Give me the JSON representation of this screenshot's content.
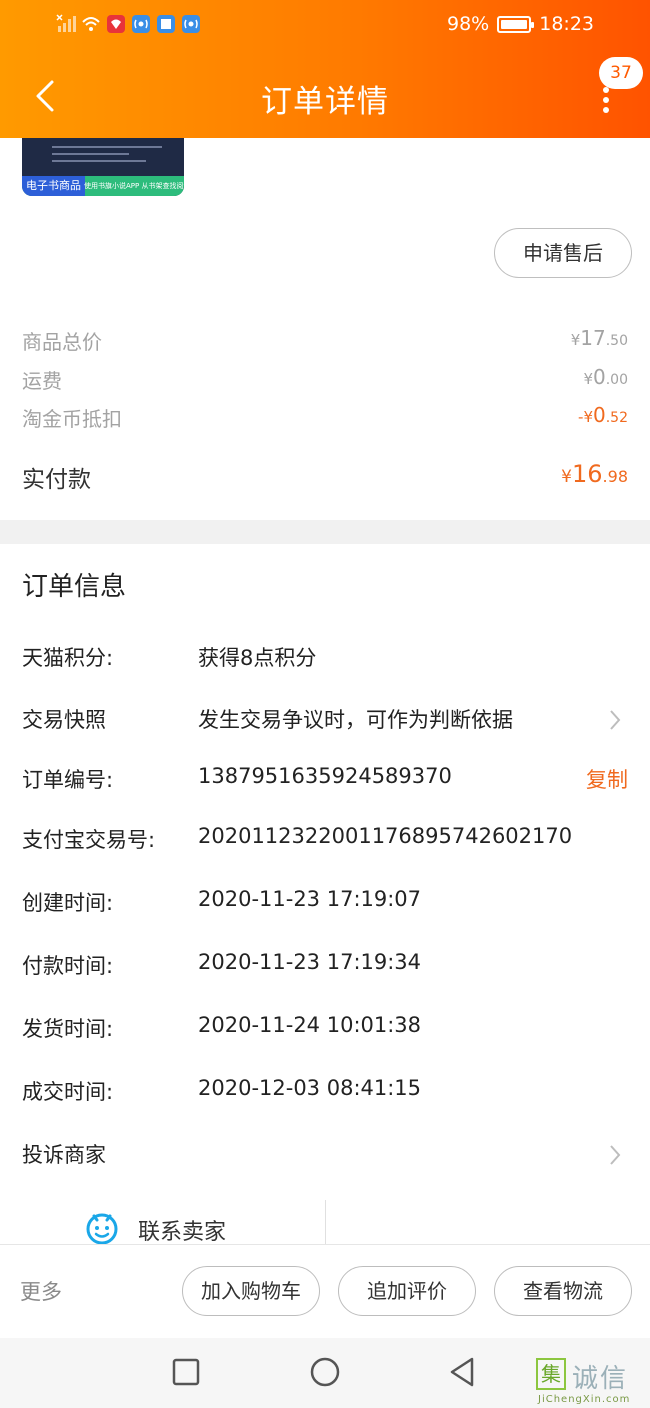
{
  "status_bar": {
    "battery": "98%",
    "battery_level": 0.98,
    "time": "18:23"
  },
  "nav": {
    "title": "订单详情",
    "badge_count": "37"
  },
  "product": {
    "cover_tag": "电子书商品",
    "cover_hint": "使用书旗小说APP 从书架查找阅读",
    "aftersale_label": "申请售后"
  },
  "prices": {
    "goods_total": {
      "label": "商品总价",
      "currency": "¥",
      "int": "17",
      "dec": ".50"
    },
    "shipping": {
      "label": "运费",
      "currency": "¥",
      "int": "0",
      "dec": ".00"
    },
    "coin_deduct": {
      "label": "淘金币抵扣",
      "currency": "-¥",
      "int": "0",
      "dec": ".52"
    },
    "paid": {
      "label": "实付款",
      "currency": "¥",
      "int": "16",
      "dec": ".98"
    }
  },
  "order_info": {
    "title": "订单信息",
    "points": {
      "label": "天猫积分:",
      "value": "获得8点积分"
    },
    "snapshot": {
      "label": "交易快照",
      "value": "发生交易争议时，可作为判断依据"
    },
    "order_no": {
      "label": "订单编号:",
      "value": "1387951635924589370",
      "copy": "复制"
    },
    "alipay_no": {
      "label": "支付宝交易号:",
      "value": "2020112322001176895742602170"
    },
    "created": {
      "label": "创建时间:",
      "value": "2020-11-23 17:19:07"
    },
    "paid_at": {
      "label": "付款时间:",
      "value": "2020-11-23 17:19:34"
    },
    "shipped": {
      "label": "发货时间:",
      "value": "2020-11-24 10:01:38"
    },
    "completed": {
      "label": "成交时间:",
      "value": "2020-12-03 08:41:15"
    },
    "complain": {
      "label": "投诉商家"
    }
  },
  "contact": {
    "label": "联系卖家"
  },
  "actions": {
    "more": "更多",
    "add_cart": "加入购物车",
    "add_review": "追加评价",
    "view_logistics": "查看物流"
  },
  "watermark": {
    "char": "集",
    "brand": "诚信",
    "url": "JiChengXin.com"
  },
  "colors": {
    "header_start": "#ff9a00",
    "header_end": "#ff5300",
    "accent": "#f06a1f"
  }
}
